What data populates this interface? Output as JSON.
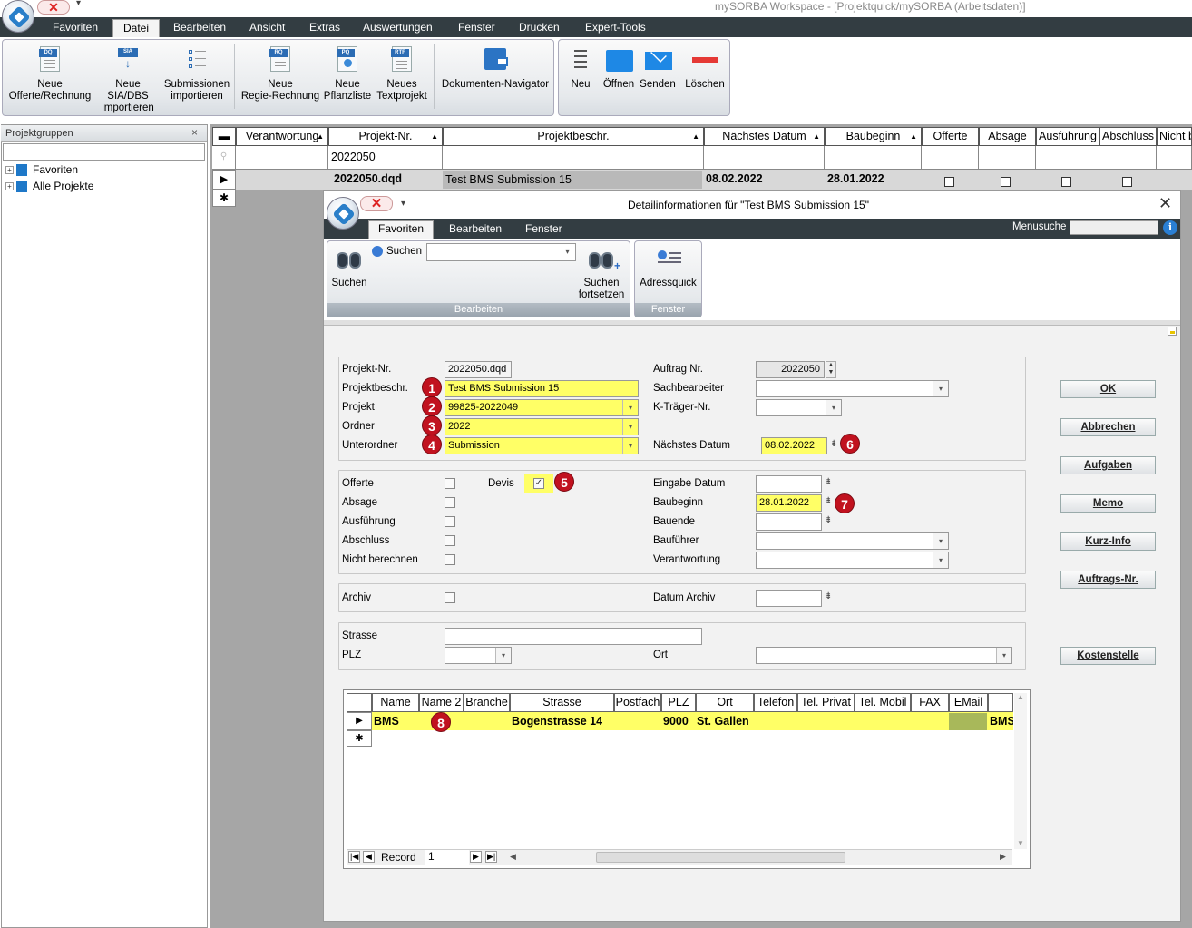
{
  "window": {
    "title": "mySORBA Workspace - [Projektquick/mySORBA (Arbeitsdaten)]"
  },
  "menu": [
    "Favoriten",
    "Datei",
    "Bearbeiten",
    "Ansicht",
    "Extras",
    "Auswertungen",
    "Fenster",
    "Drucken",
    "Expert-Tools"
  ],
  "ribbon": {
    "neue_offerte": [
      "Neue",
      "Offerte/Rechnung"
    ],
    "neue_sia": [
      "Neue SIA/DBS",
      "importieren"
    ],
    "submissionen": [
      "Submissionen",
      "importieren"
    ],
    "neue_regie": [
      "Neue",
      "Regie-Rechnung"
    ],
    "neue_pflanzliste": [
      "Neue",
      "Pflanzliste"
    ],
    "neues_textprojekt": [
      "Neues",
      "Textprojekt"
    ],
    "dokumenten_navigator": "Dokumenten-Navigator",
    "neu": "Neu",
    "oeffnen": "Öffnen",
    "senden": "Senden",
    "loeschen": "Löschen",
    "icon_tags": {
      "dq": "DQ",
      "sia": "SIA",
      "rq": "RQ",
      "pq": "PQ",
      "rtf": "RTF"
    }
  },
  "projektgruppen": {
    "title": "Projektgruppen",
    "close": "×",
    "items": [
      {
        "label": "Favoriten",
        "expander": "+"
      },
      {
        "label": "Alle Projekte",
        "expander": "+"
      }
    ]
  },
  "grid": {
    "headers": [
      "Verantwortung",
      "Projekt-Nr.",
      "Projektbeschr.",
      "Nächstes Datum",
      "Baubeginn",
      "Offerte",
      "Absage",
      "Ausführung",
      "Abschluss",
      "Nicht b"
    ],
    "filter_nr": "2022050",
    "row": {
      "nr": "2022050.dqd",
      "beschr": "Test BMS Submission 15",
      "naechstes": "08.02.2022",
      "baubeginn": "28.01.2022"
    }
  },
  "dialog": {
    "title": "Detailinformationen für \"Test BMS Submission 15\"",
    "menu": [
      "Favoriten",
      "Bearbeiten",
      "Fenster"
    ],
    "menusuche": "Menusuche",
    "info": "i",
    "ribbon": {
      "suchen_small": "Suchen",
      "suchen": "Suchen",
      "suchen_fort": [
        "Suchen",
        "fortsetzen"
      ],
      "adressquick": "Adressquick",
      "group1": "Bearbeiten",
      "group2": "Fenster"
    },
    "labels": {
      "projekt_nr": "Projekt-Nr.",
      "projektbeschr": "Projektbeschr.",
      "projekt": "Projekt",
      "ordner": "Ordner",
      "unterordner": "Unterordner",
      "auftrag_nr": "Auftrag Nr.",
      "sachbearbeiter": "Sachbearbeiter",
      "ktraeger": "K-Träger-Nr.",
      "naechstes_datum": "Nächstes Datum",
      "offerte": "Offerte",
      "absage": "Absage",
      "ausfuehrung": "Ausführung",
      "abschluss": "Abschluss",
      "nicht_berechnen": "Nicht berechnen",
      "devis": "Devis",
      "eingabe_datum": "Eingabe Datum",
      "baubeginn": "Baubeginn",
      "bauende": "Bauende",
      "baufuehrer": "Bauführer",
      "verantwortung": "Verantwortung",
      "archiv": "Archiv",
      "datum_archiv": "Datum Archiv",
      "strasse": "Strasse",
      "plz": "PLZ",
      "ort": "Ort"
    },
    "values": {
      "projekt_nr": "2022050.dqd",
      "projektbeschr": "Test BMS Submission 15",
      "projekt": "99825-2022049",
      "ordner": "2022",
      "unterordner": "Submission",
      "auftrag_nr": "2022050",
      "naechstes_datum": "08.02.2022",
      "baubeginn": "28.01.2022"
    },
    "buttons": [
      "OK",
      "Abbrechen",
      "Aufgaben",
      "Memo",
      "Kurz-Info",
      "Auftrags-Nr.",
      "Kostenstelle"
    ],
    "badges": [
      "1",
      "2",
      "3",
      "4",
      "5",
      "6",
      "7",
      "8"
    ],
    "address_grid": {
      "headers": [
        "Name",
        "Name 2",
        "Branche",
        "Strasse",
        "Postfach",
        "PLZ",
        "Ort",
        "Telefon",
        "Tel. Privat",
        "Tel. Mobil",
        "FAX",
        "EMail"
      ],
      "row": {
        "name": "BMS",
        "strasse": "Bogenstrasse 14",
        "plz": "9000",
        "ort": "St. Gallen",
        "extra": "BMS"
      },
      "record_label": "Record",
      "record_value": "1"
    }
  },
  "colors": {
    "menubar": "#333d42",
    "highlight": "#ffff66",
    "badge": "#c1121f",
    "grid_bg": "#a6a6a6"
  }
}
